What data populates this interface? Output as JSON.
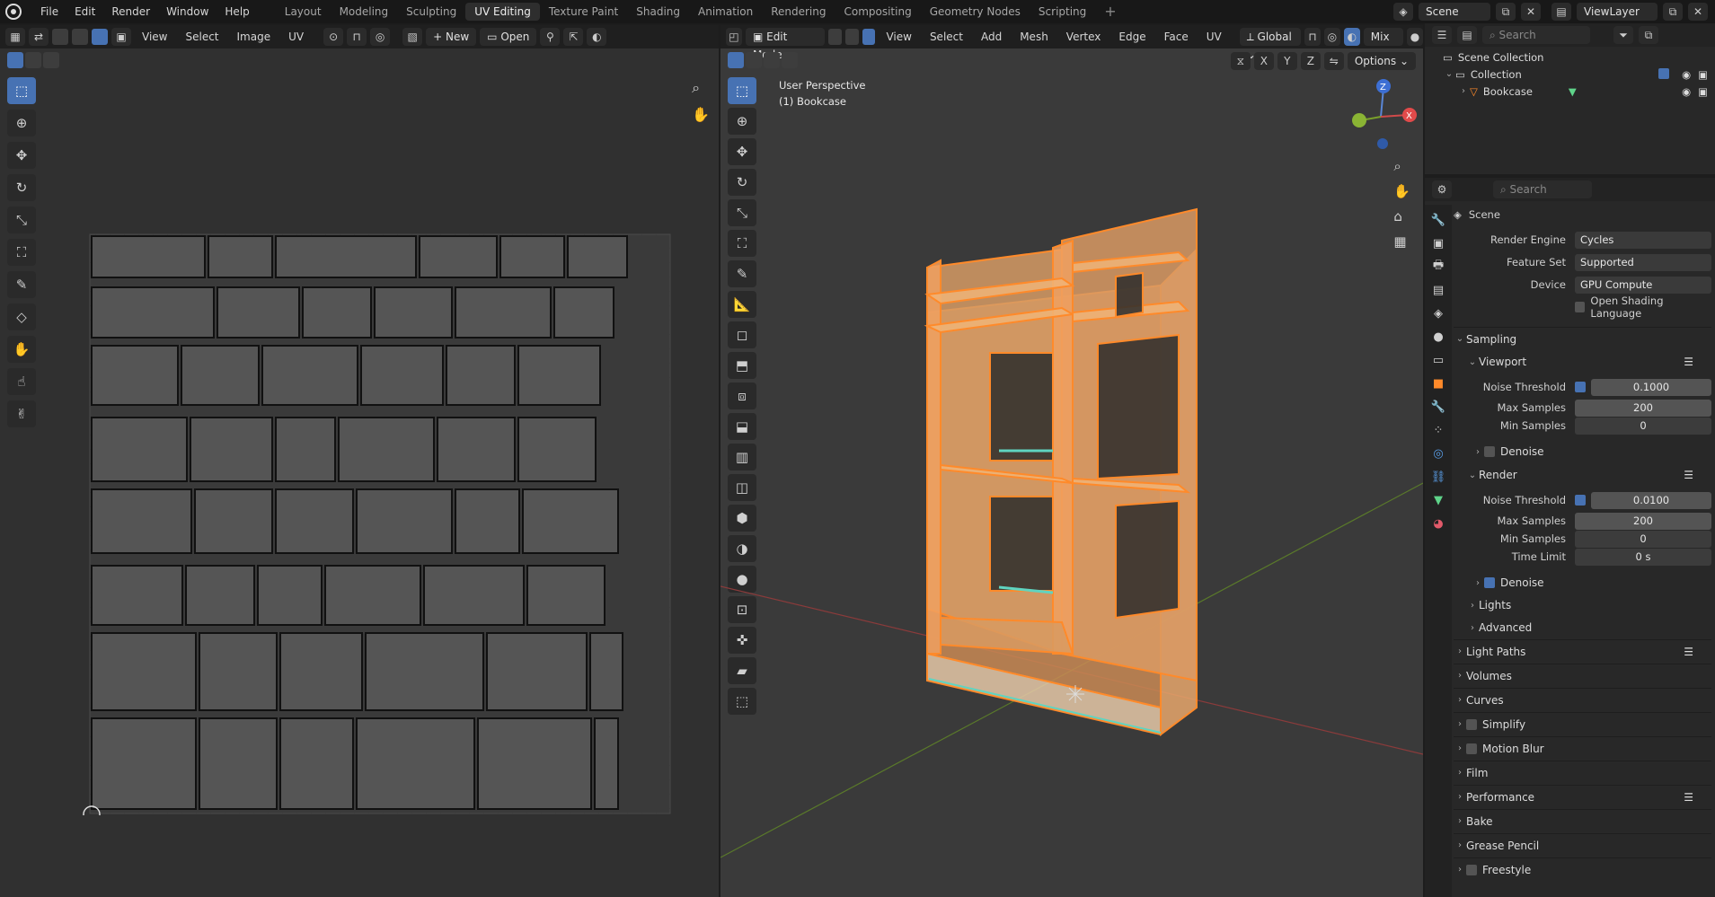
{
  "menu": {
    "file": "File",
    "edit": "Edit",
    "render": "Render",
    "window": "Window",
    "help": "Help"
  },
  "workspaces": [
    "Layout",
    "Modeling",
    "Sculpting",
    "UV Editing",
    "Texture Paint",
    "Shading",
    "Animation",
    "Rendering",
    "Compositing",
    "Geometry Nodes",
    "Scripting"
  ],
  "active_workspace": "UV Editing",
  "scene_field": "Scene",
  "viewlayer_field": "ViewLayer",
  "uv_header": {
    "view": "View",
    "select": "Select",
    "image": "Image",
    "uv": "UV",
    "new": "New",
    "open": "Open"
  },
  "viewport_header": {
    "mode": "Edit Mode",
    "view": "View",
    "select": "Select",
    "add": "Add",
    "mesh": "Mesh",
    "vertex": "Vertex",
    "edge": "Edge",
    "face": "Face",
    "uv": "UV",
    "orientation": "Global",
    "shading": "Mix",
    "options": "Options",
    "x": "X",
    "y": "Y",
    "z": "Z"
  },
  "viewport_overlay": {
    "perspective": "User Perspective",
    "object": "(1) Bookcase"
  },
  "gizmo": {
    "x": "X",
    "y": "Y",
    "z": "Z"
  },
  "outliner": {
    "search": "Search",
    "scene_collection": "Scene Collection",
    "collection": "Collection",
    "object": "Bookcase"
  },
  "properties": {
    "search": "Search",
    "context": "Scene",
    "render_engine_label": "Render Engine",
    "render_engine": "Cycles",
    "feature_set_label": "Feature Set",
    "feature_set": "Supported",
    "device_label": "Device",
    "device": "GPU Compute",
    "osl": "Open Shading Language",
    "sampling": "Sampling",
    "viewport": "Viewport",
    "vp_noise_label": "Noise Threshold",
    "vp_noise": "0.1000",
    "vp_max_label": "Max Samples",
    "vp_max": "200",
    "vp_min_label": "Min Samples",
    "vp_min": "0",
    "vp_denoise": "Denoise",
    "render": "Render",
    "r_noise_label": "Noise Threshold",
    "r_noise": "0.0100",
    "r_max_label": "Max Samples",
    "r_max": "200",
    "r_min_label": "Min Samples",
    "r_min": "0",
    "r_time_label": "Time Limit",
    "r_time": "0 s",
    "r_denoise": "Denoise",
    "lights": "Lights",
    "advanced": "Advanced",
    "light_paths": "Light Paths",
    "volumes": "Volumes",
    "curves": "Curves",
    "simplify": "Simplify",
    "motion_blur": "Motion Blur",
    "film": "Film",
    "performance": "Performance",
    "bake": "Bake",
    "grease_pencil": "Grease Pencil",
    "freestyle": "Freestyle"
  },
  "colors": {
    "accent": "#4772b3",
    "selection": "#ff8a2a",
    "face": "#e8a76c",
    "seam": "#5fd4c0"
  }
}
